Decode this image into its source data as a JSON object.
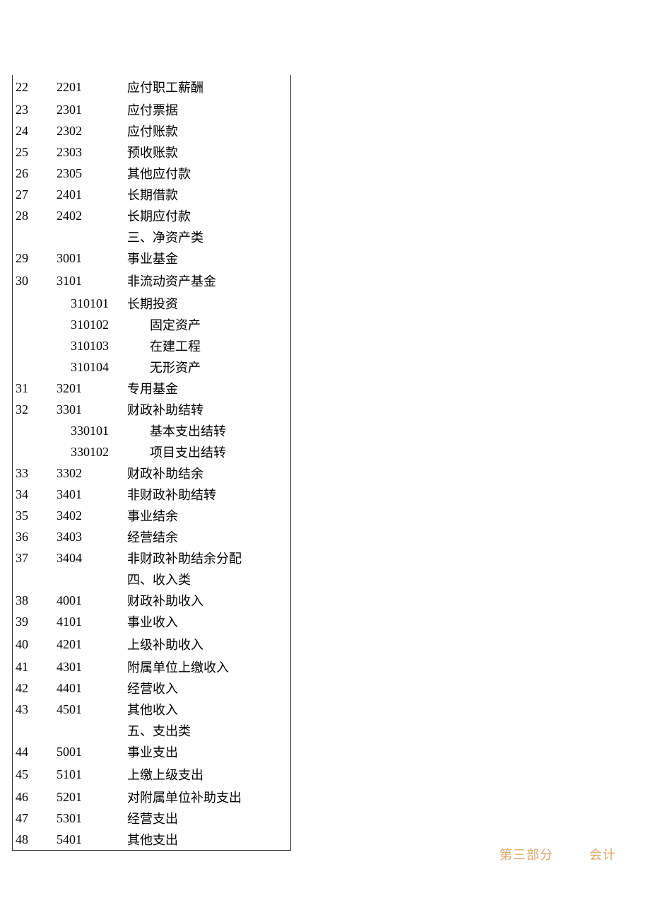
{
  "rows": [
    {
      "seq": "22",
      "code": "2201",
      "name": "应付职工薪酬",
      "cls": "spacer"
    },
    {
      "seq": "23",
      "code": "2301",
      "name": "应付票据",
      "cls": ""
    },
    {
      "seq": "24",
      "code": "2302",
      "name": "应付账款",
      "cls": ""
    },
    {
      "seq": "25",
      "code": "2303",
      "name": "预收账款",
      "cls": ""
    },
    {
      "seq": "26",
      "code": "2305",
      "name": "其他应付款",
      "cls": ""
    },
    {
      "seq": "27",
      "code": "2401",
      "name": "长期借款",
      "cls": ""
    },
    {
      "seq": "28",
      "code": "2402",
      "name": "长期应付款",
      "cls": ""
    },
    {
      "seq": "",
      "code": "",
      "name": "三、净资产类",
      "cls": "tight",
      "header": true
    },
    {
      "seq": "29",
      "code": "3001",
      "name": "事业基金",
      "cls": ""
    },
    {
      "seq": "30",
      "code": "3101",
      "name": "非流动资产基金",
      "cls": "spacer"
    },
    {
      "seq": "",
      "subcode": "310101",
      "name": "长期投资",
      "cls": "",
      "sub": false
    },
    {
      "seq": "",
      "subcode": "310102",
      "name": "固定资产",
      "cls": "",
      "sub": true
    },
    {
      "seq": "",
      "subcode": "310103",
      "name": "在建工程",
      "cls": "",
      "sub": true
    },
    {
      "seq": "",
      "subcode": "310104",
      "name": "无形资产",
      "cls": "",
      "sub": true
    },
    {
      "seq": "31",
      "code": "3201",
      "name": "专用基金",
      "cls": ""
    },
    {
      "seq": "32",
      "code": "3301",
      "name": "财政补助结转",
      "cls": ""
    },
    {
      "seq": "",
      "subcode": "330101",
      "name": "基本支出结转",
      "cls": "",
      "sub": true
    },
    {
      "seq": "",
      "subcode": "330102",
      "name": "项目支出结转",
      "cls": "",
      "sub": true
    },
    {
      "seq": "33",
      "code": "3302",
      "name": "财政补助结余",
      "cls": ""
    },
    {
      "seq": "34",
      "code": "3401",
      "name": "非财政补助结转",
      "cls": ""
    },
    {
      "seq": "35",
      "code": "3402",
      "name": "事业结余",
      "cls": ""
    },
    {
      "seq": "36",
      "code": "3403",
      "name": "经营结余",
      "cls": ""
    },
    {
      "seq": "37",
      "code": "3404",
      "name": "非财政补助结余分配",
      "cls": ""
    },
    {
      "seq": "",
      "code": "",
      "name": "四、收入类",
      "cls": "",
      "header": true
    },
    {
      "seq": "38",
      "code": "4001",
      "name": "财政补助收入",
      "cls": "tight"
    },
    {
      "seq": "39",
      "code": "4101",
      "name": "事业收入",
      "cls": "tight"
    },
    {
      "seq": "40",
      "code": "4201",
      "name": "上级补助收入",
      "cls": "spacer"
    },
    {
      "seq": "41",
      "code": "4301",
      "name": "附属单位上缴收入",
      "cls": ""
    },
    {
      "seq": "42",
      "code": "4401",
      "name": "经营收入",
      "cls": ""
    },
    {
      "seq": "43",
      "code": "4501",
      "name": "其他收入",
      "cls": ""
    },
    {
      "seq": "",
      "code": "",
      "name": "五、支出类",
      "cls": "tight",
      "header": true
    },
    {
      "seq": "44",
      "code": "5001",
      "name": "事业支出",
      "cls": ""
    },
    {
      "seq": "45",
      "code": "5101",
      "name": "上缴上级支出",
      "cls": "spacer"
    },
    {
      "seq": "46",
      "code": "5201",
      "name": "对附属单位补助支出",
      "cls": "tight"
    },
    {
      "seq": "47",
      "code": "5301",
      "name": "经营支出",
      "cls": "tight"
    },
    {
      "seq": "48",
      "code": "5401",
      "name": "其他支出",
      "cls": ""
    }
  ],
  "footer": {
    "part": "第三部分",
    "label": "会计"
  }
}
